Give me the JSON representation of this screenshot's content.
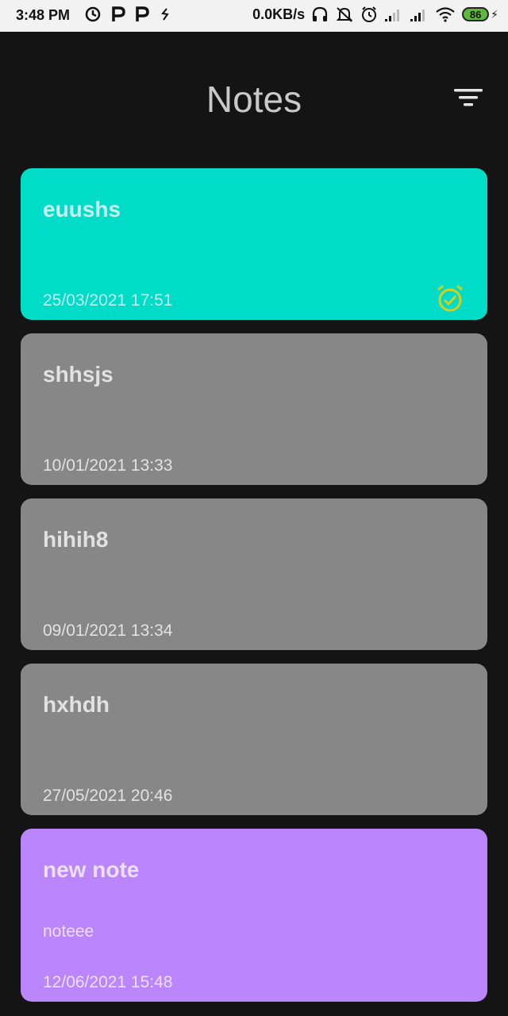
{
  "status_bar": {
    "time": "3:48 PM",
    "net_speed": "0.0KB/s",
    "battery": "86",
    "left_icons": [
      "sync-icon",
      "p-app-icon",
      "p-app-icon",
      "phone-arrow-icon"
    ],
    "right_icons": [
      "headphones-icon",
      "alarm-off-icon",
      "alarm-icon",
      "signal-icon",
      "signal-icon",
      "wifi-icon",
      "battery-icon",
      "charging-icon"
    ]
  },
  "header": {
    "title": "Notes",
    "filter_icon": "filter-icon"
  },
  "notes": [
    {
      "title": "euushs",
      "body": "",
      "date": "25/03/2021 17:51",
      "color": "#00dcc7",
      "text_color": "#c6f3ef",
      "has_alarm": true,
      "alarm_color": "#d6cf19"
    },
    {
      "title": "shhsjs",
      "body": "",
      "date": "10/01/2021 13:33",
      "color": "#878787",
      "text_color": "#e2e2e2",
      "has_alarm": false
    },
    {
      "title": "hihih8",
      "body": "",
      "date": "09/01/2021 13:34",
      "color": "#878787",
      "text_color": "#e2e2e2",
      "has_alarm": false
    },
    {
      "title": "hxhdh",
      "body": "",
      "date": "27/05/2021 20:46",
      "color": "#878787",
      "text_color": "#e2e2e2",
      "has_alarm": false
    },
    {
      "title": "new note",
      "body": "noteee",
      "date": "12/06/2021 15:48",
      "color": "#bb86fc",
      "text_color": "#ece0fd",
      "has_alarm": false
    }
  ],
  "colors": {
    "background": "#141414",
    "status_bar_bg": "#f2f2f2",
    "title": "#c9c9c9"
  }
}
